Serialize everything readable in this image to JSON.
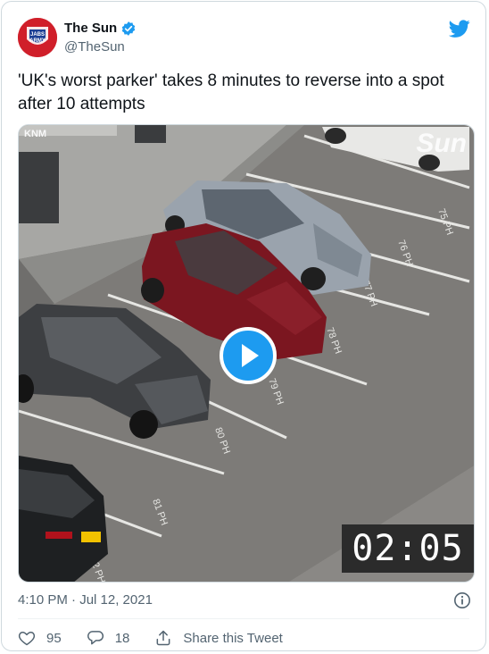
{
  "account": {
    "name": "The Sun",
    "handle": "@TheSun",
    "avatar_text": "JABS ARMY"
  },
  "tweet": {
    "text": "'UK's worst parker' takes 8 minutes to reverse into a spot after 10 attempts",
    "timestamp": "4:10 PM · Jul 12, 2021"
  },
  "video": {
    "timer": "02:05",
    "watermark_left": "KNM",
    "watermark_right": "Sun",
    "bay_labels": [
      "75 PH",
      "76 PH",
      "77 PH",
      "78 PH",
      "79 PH",
      "80 PH",
      "81 PH",
      "82 PH"
    ]
  },
  "actions": {
    "likes": "95",
    "replies": "18",
    "share": "Share this Tweet"
  },
  "colors": {
    "accent": "#1d9bf0",
    "muted": "#536471"
  },
  "icons": [
    "verified-badge-icon",
    "twitter-bird-icon",
    "play-icon",
    "info-icon",
    "heart-icon",
    "reply-icon",
    "share-icon"
  ]
}
